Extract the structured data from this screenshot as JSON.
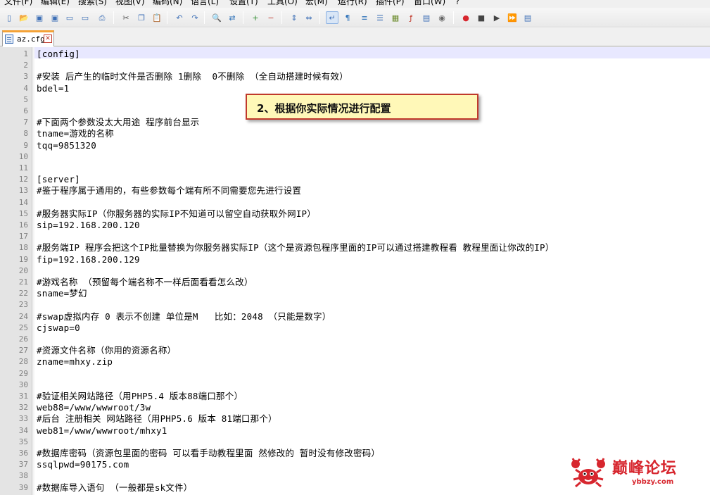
{
  "menu": [
    "文件(F)",
    "编辑(E)",
    "搜索(S)",
    "视图(V)",
    "编码(N)",
    "语言(L)",
    "设置(T)",
    "工具(O)",
    "宏(M)",
    "运行(R)",
    "插件(P)",
    "窗口(W)",
    "?"
  ],
  "toolbar_icons": [
    "new-file-icon",
    "open-file-icon",
    "save-icon",
    "save-all-icon",
    "close-icon",
    "close-all-icon",
    "print-icon",
    "cut-icon",
    "copy-icon",
    "paste-icon",
    "undo-icon",
    "redo-icon",
    "find-icon",
    "replace-icon",
    "zoom-in-icon",
    "zoom-out-icon",
    "sync-vertical-icon",
    "sync-horizontal-icon",
    "word-wrap-icon",
    "show-all-chars-icon",
    "indent-guide-icon",
    "user-lang-icon",
    "doc-map-icon",
    "function-list-icon",
    "folder-workspace-icon",
    "monitor-icon",
    "record-macro-icon",
    "stop-record-icon",
    "play-macro-icon",
    "run-macro-multiple-icon",
    "save-macro-icon"
  ],
  "tab": {
    "name": "az.cfg"
  },
  "lines": [
    {
      "n": "1",
      "t": "[config]"
    },
    {
      "n": "2",
      "t": ""
    },
    {
      "n": "3",
      "t": "#安装 后产生的临时文件是否删除 1删除  0不删除 （全自动搭建时候有效）"
    },
    {
      "n": "4",
      "t": "bdel=1"
    },
    {
      "n": "5",
      "t": ""
    },
    {
      "n": "6",
      "t": ""
    },
    {
      "n": "7",
      "t": "#下面两个参数没太大用途 程序前台显示"
    },
    {
      "n": "8",
      "t": "tname=游戏的名称"
    },
    {
      "n": "9",
      "t": "tqq=9851320"
    },
    {
      "n": "10",
      "t": ""
    },
    {
      "n": "11",
      "t": ""
    },
    {
      "n": "12",
      "t": "[server]"
    },
    {
      "n": "13",
      "t": "#鉴于程序属于通用的，有些参数每个端有所不同需要您先进行设置"
    },
    {
      "n": "14",
      "t": ""
    },
    {
      "n": "15",
      "t": "#服务器实际IP（你服务器的实际IP不知道可以留空自动获取外网IP）"
    },
    {
      "n": "16",
      "t": "sip=192.168.200.120"
    },
    {
      "n": "17",
      "t": ""
    },
    {
      "n": "18",
      "t": "#服务端IP 程序会把这个IP批量替换为你服务器实际IP（这个是资源包程序里面的IP可以通过搭建教程看 教程里面让你改的IP）"
    },
    {
      "n": "19",
      "t": "fip=192.168.200.129"
    },
    {
      "n": "20",
      "t": ""
    },
    {
      "n": "21",
      "t": "#游戏名称 （预留每个端名称不一样后面看看怎么改）"
    },
    {
      "n": "22",
      "t": "sname=梦幻"
    },
    {
      "n": "23",
      "t": ""
    },
    {
      "n": "24",
      "t": "#swap虚拟内存 0 表示不创建 单位是M   比如：2048 （只能是数字）"
    },
    {
      "n": "25",
      "t": "cjswap=0"
    },
    {
      "n": "26",
      "t": ""
    },
    {
      "n": "27",
      "t": "#资源文件名称（你用的资源名称）"
    },
    {
      "n": "28",
      "t": "zname=mhxy.zip"
    },
    {
      "n": "29",
      "t": ""
    },
    {
      "n": "30",
      "t": ""
    },
    {
      "n": "31",
      "t": "#验证相关网站路径（用PHP5.4 版本88端口那个）"
    },
    {
      "n": "32",
      "t": "web88=/www/wwwroot/3w"
    },
    {
      "n": "33",
      "t": "#后台 注册相关 网站路径（用PHP5.6 版本 81端口那个）"
    },
    {
      "n": "34",
      "t": "web81=/www/wwwroot/mhxy1"
    },
    {
      "n": "35",
      "t": ""
    },
    {
      "n": "36",
      "t": "#数据库密码（资源包里面的密码 可以看手动教程里面 然修改的 暂时没有修改密码）"
    },
    {
      "n": "37",
      "t": "ssqlpwd=90175.com"
    },
    {
      "n": "38",
      "t": ""
    },
    {
      "n": "39",
      "t": "#数据库导入语句 （一般都是sk文件）"
    }
  ],
  "callout": {
    "text": "2、根据你实际情况进行配置"
  },
  "watermark": {
    "text": "巅峰论坛",
    "url": "ybbzy.com"
  },
  "colors": {
    "callout_bg": "#fff8b8",
    "callout_border": "#c0392b",
    "tab_accent": "#f4a236",
    "watermark": "#d7262e"
  }
}
